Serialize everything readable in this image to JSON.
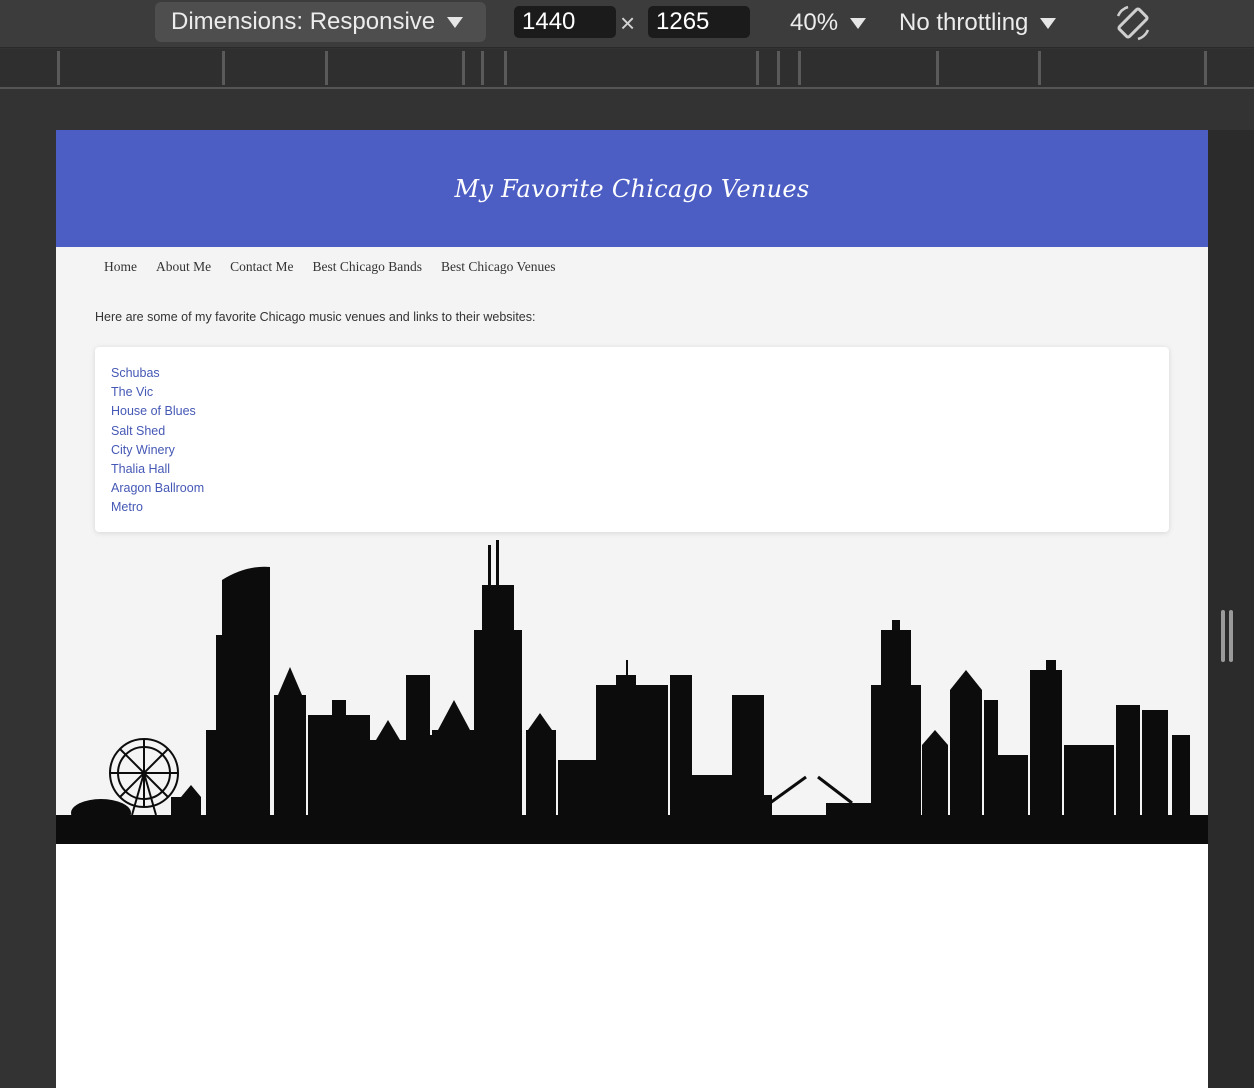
{
  "devtools": {
    "dimensions_label": "Dimensions: Responsive",
    "width_value": "1440",
    "times_symbol": "×",
    "height_value": "1265",
    "zoom_label": "40%",
    "throttling_label": "No throttling"
  },
  "site": {
    "title": "My Favorite Chicago Venues",
    "nav": [
      {
        "label": "Home"
      },
      {
        "label": "About Me"
      },
      {
        "label": "Contact Me"
      },
      {
        "label": "Best Chicago Bands"
      },
      {
        "label": "Best Chicago Venues"
      }
    ],
    "intro": "Here are some of my favorite Chicago music venues and links to their websites:",
    "venues": [
      {
        "label": "Schubas"
      },
      {
        "label": "The Vic"
      },
      {
        "label": "House of Blues"
      },
      {
        "label": "Salt Shed"
      },
      {
        "label": "City Winery"
      },
      {
        "label": "Thalia Hall"
      },
      {
        "label": "Aragon Ballroom"
      },
      {
        "label": "Metro"
      }
    ]
  },
  "colors": {
    "header_bg": "#4c5ec3",
    "body_bg": "#f4f4f4",
    "link": "#4558b5",
    "devtools_bg": "#3c3c3c"
  },
  "icons": {
    "dimension_dropdown": "caret-down-icon",
    "rotate": "rotate-device-icon",
    "resize": "resize-handle-icon"
  }
}
